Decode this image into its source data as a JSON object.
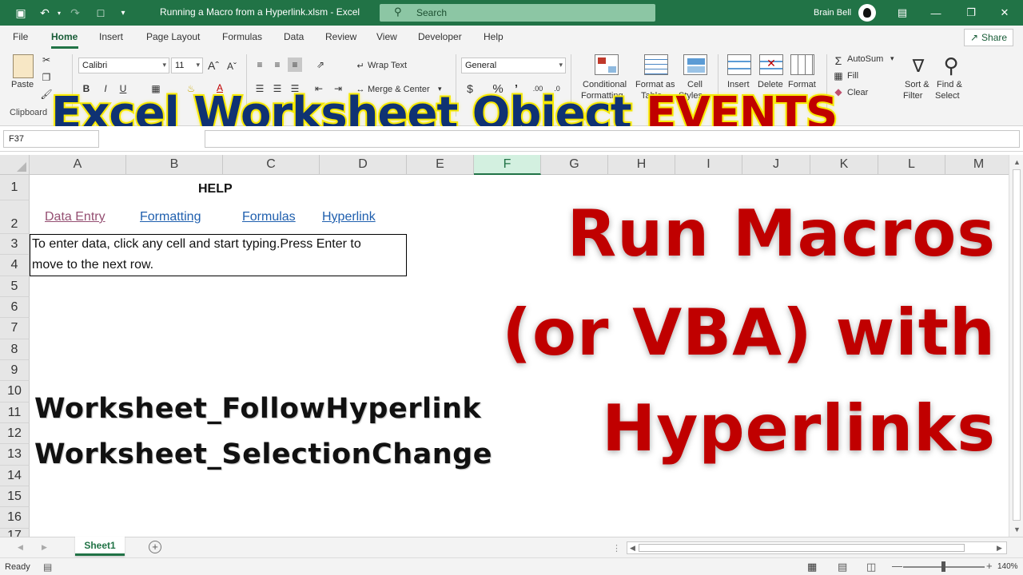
{
  "window": {
    "title": "Running a Macro from a Hyperlink.xlsm  -  Excel",
    "search_placeholder": "Search",
    "user_name": "Brain Bell"
  },
  "ribbon_tabs": [
    "File",
    "Home",
    "Insert",
    "Page Layout",
    "Formulas",
    "Data",
    "Review",
    "View",
    "Developer",
    "Help"
  ],
  "share_label": "Share",
  "ribbon": {
    "paste_label": "Paste",
    "clipboard_label": "Clipboard",
    "font_name": "Calibri",
    "font_size": "11",
    "bold": "B",
    "italic": "I",
    "underline": "U",
    "wrap_text": "Wrap Text",
    "merge_center": "Merge & Center",
    "number_format": "General",
    "conditional_formatting": [
      "Conditional",
      "Formatting"
    ],
    "format_as_table": [
      "Format as",
      "Table"
    ],
    "cell_styles": [
      "Cell",
      "Styles"
    ],
    "insert": "Insert",
    "delete": "Delete",
    "format": "Format",
    "autosum": "AutoSum",
    "fill": "Fill",
    "clear": "Clear",
    "sort_filter": [
      "Sort &",
      "Filter"
    ],
    "find_select": [
      "Find &",
      "Select"
    ]
  },
  "banner": {
    "part1": "Excel Worksheet Object ",
    "part2": "EVENTS"
  },
  "formula_bar": {
    "name_box": "F37"
  },
  "columns": [
    "A",
    "B",
    "C",
    "D",
    "E",
    "F",
    "G",
    "H",
    "I",
    "J",
    "K",
    "L",
    "M"
  ],
  "selected_column": "F",
  "rows": [
    "1",
    "2",
    "3",
    "4",
    "5",
    "6",
    "7",
    "8",
    "9",
    "10",
    "11",
    "12",
    "13",
    "14",
    "15",
    "16",
    "17"
  ],
  "sheet": {
    "help_heading": "HELP",
    "links": [
      "Data Entry",
      "Formatting",
      "Formulas",
      "Hyperlink"
    ],
    "help_line1": "To enter data, click any cell and start typing.Press Enter to",
    "help_line2": "move to the next row.",
    "event1": "Worksheet_FollowHyperlink",
    "event2": "Worksheet_SelectionChange"
  },
  "overlay": {
    "line1": "Run Macros",
    "line2": "(or VBA) with",
    "line3": "Hyperlinks"
  },
  "sheet_tabs": [
    "Sheet1"
  ],
  "status": {
    "ready": "Ready",
    "zoom": "140%"
  },
  "colors": {
    "excel_green": "#217346",
    "title_red": "#c00000",
    "banner_navy": "#0f3273",
    "banner_yellow": "#f3e800",
    "hyperlink_blue": "#1f5fae",
    "visited_link": "#954f72"
  }
}
